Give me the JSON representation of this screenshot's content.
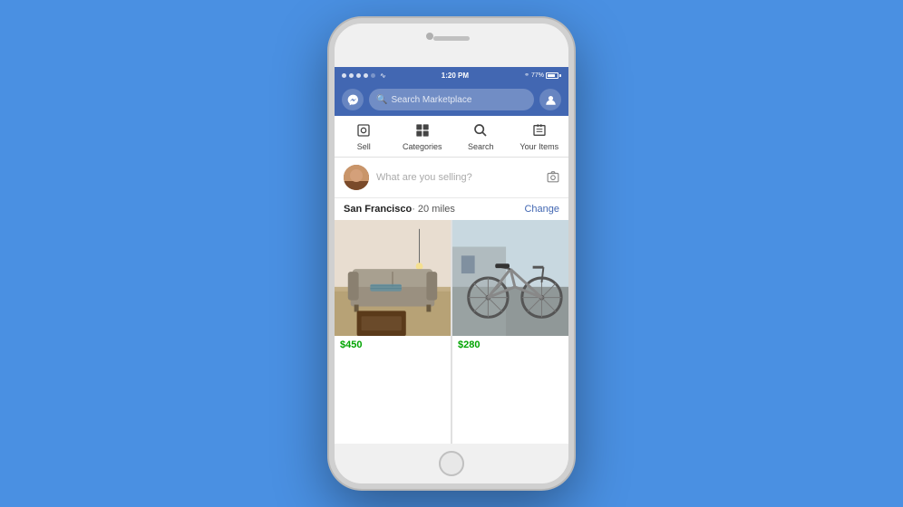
{
  "background": "#4A90E2",
  "statusBar": {
    "time": "1:20 PM",
    "battery": "77%",
    "signals": [
      "●",
      "●",
      "●",
      "●",
      "○"
    ]
  },
  "navbar": {
    "searchPlaceholder": "Search Marketplace"
  },
  "tabs": [
    {
      "id": "sell",
      "label": "Sell",
      "icon": "📷"
    },
    {
      "id": "categories",
      "label": "Categories",
      "icon": "🏷"
    },
    {
      "id": "search",
      "label": "Search",
      "icon": "🔍"
    },
    {
      "id": "your-items",
      "label": "Your Items",
      "icon": "🗂"
    }
  ],
  "sellArea": {
    "placeholder": "What are you selling?"
  },
  "location": {
    "city": "San Francisco",
    "distance": "· 20 miles",
    "changeLabel": "Change"
  },
  "products": [
    {
      "id": "sofa",
      "price": "$450",
      "type": "sofa"
    },
    {
      "id": "bike",
      "price": "$280",
      "type": "bike"
    }
  ]
}
